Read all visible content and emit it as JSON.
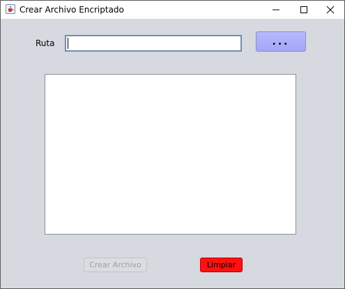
{
  "window": {
    "title": "Crear Archivo Encriptado",
    "app_icon": "java-cup-icon",
    "controls": {
      "minimize_icon": "minimize-icon",
      "maximize_icon": "maximize-icon",
      "close_icon": "close-icon"
    }
  },
  "form": {
    "ruta_label": "Ruta",
    "ruta_value": "",
    "browse_label": "...",
    "content_text": ""
  },
  "buttons": {
    "crear_label": "Crear Archivo",
    "crear_enabled": false,
    "limpiar_label": "Limpiar"
  },
  "colors": {
    "background": "#d6d9df",
    "browse_button": "#aeb0fb",
    "limpiar_button": "#ff1111",
    "input_border": "#6d8db8"
  }
}
